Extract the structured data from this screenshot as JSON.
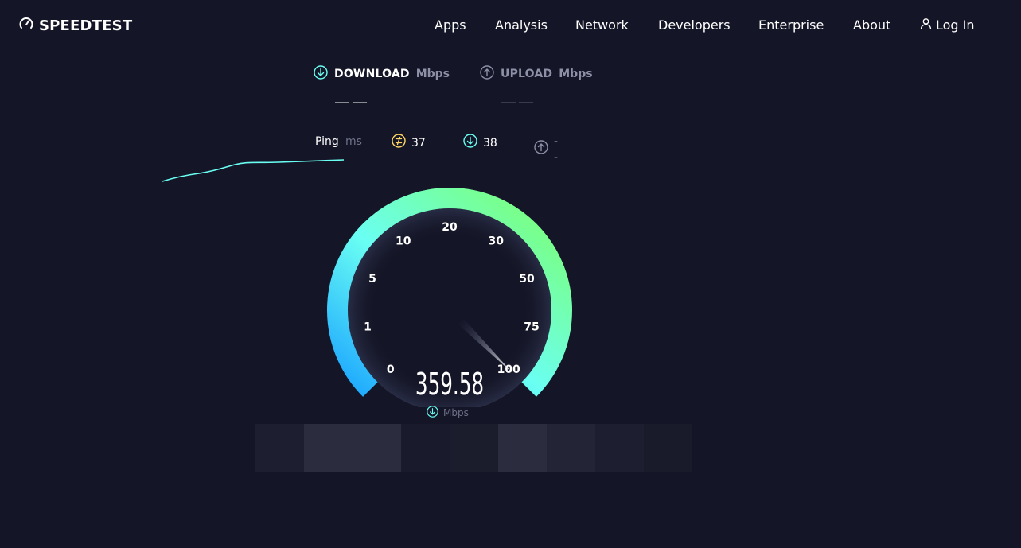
{
  "header": {
    "logo_text": "SPEEDTEST",
    "nav": [
      "Apps",
      "Analysis",
      "Network",
      "Developers",
      "Enterprise",
      "About"
    ],
    "login_label": "Log In"
  },
  "results": {
    "download": {
      "label": "DOWNLOAD",
      "unit": "Mbps",
      "value": "——"
    },
    "upload": {
      "label": "UPLOAD",
      "unit": "Mbps",
      "value": "——"
    }
  },
  "ping": {
    "label": "Ping",
    "unit": "ms",
    "idle": "37",
    "download": "38",
    "upload": "--"
  },
  "gauge": {
    "speed": "359.58",
    "unit": "Mbps",
    "ticks": [
      "0",
      "1",
      "5",
      "10",
      "20",
      "30",
      "50",
      "75",
      "100"
    ],
    "progress_fraction": 1.0
  },
  "colors": {
    "background": "#141526",
    "accent_cyan": "#6afff3",
    "accent_green": "#7dff6b",
    "accent_blue": "#1aa3ff",
    "ping_yellow": "#ffd766"
  }
}
